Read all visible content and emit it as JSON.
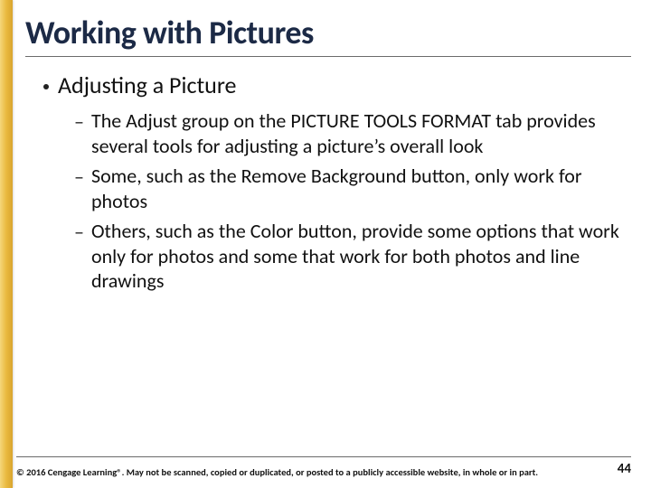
{
  "title": "Working with Pictures",
  "bullets": {
    "level1": "Adjusting a Picture",
    "level2": [
      "The Adjust group on the PICTURE TOOLS FORMAT tab provides several tools for adjusting a picture’s overall look",
      "Some, such as the Remove Background button, only work for photos",
      "Others, such as the Color button, provide some options that work only for photos and some that work for both photos and line drawings"
    ]
  },
  "footer": {
    "copyright": "© 2016 Cengage Learning®. May not be scanned, copied or duplicated, or posted to a publicly accessible website, in whole or in part.",
    "page": "44"
  }
}
